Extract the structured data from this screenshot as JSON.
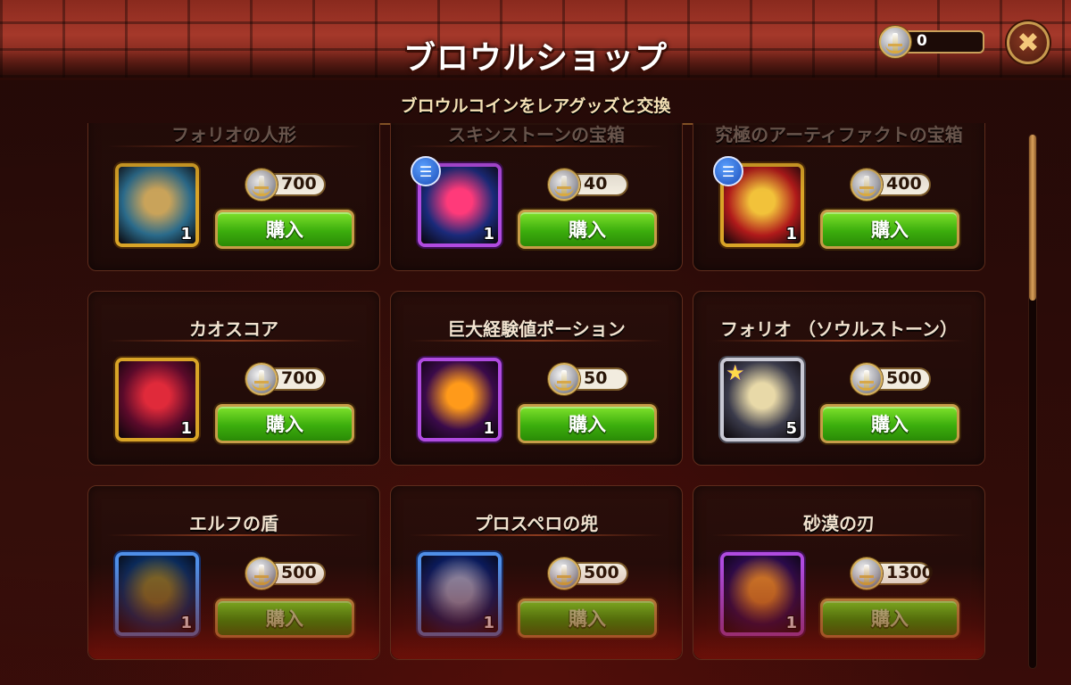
{
  "header": {
    "title": "ブロウルショップ",
    "subtitle": "ブロウルコインをレアグッズと交換",
    "coin_balance": "0",
    "close_icon": "close-icon"
  },
  "shop": {
    "buy_label": "購入",
    "items": [
      {
        "name": "フォリオの人形",
        "price": "700",
        "qty": "1",
        "frame": "gold",
        "info": false,
        "icon": "doll-icon",
        "colors": [
          "#2a6a8a",
          "#c9a35a"
        ]
      },
      {
        "name": "スキンストーンの宝箱",
        "price": "40",
        "qty": "1",
        "frame": "purple",
        "info": true,
        "icon": "skin-chest-icon",
        "colors": [
          "#1a2a7a",
          "#ff3a7a"
        ]
      },
      {
        "name": "究極のアーティファクトの宝箱",
        "price": "400",
        "qty": "1",
        "frame": "gold",
        "info": true,
        "icon": "artifact-chest-icon",
        "colors": [
          "#b01a1a",
          "#f2c23a"
        ]
      },
      {
        "name": "カオスコア",
        "price": "700",
        "qty": "1",
        "frame": "gold",
        "info": false,
        "icon": "chaos-core-icon",
        "colors": [
          "#5a0a2a",
          "#e02a3a"
        ]
      },
      {
        "name": "巨大経験値ポーション",
        "price": "50",
        "qty": "1",
        "frame": "purple",
        "info": false,
        "icon": "exp-potion-icon",
        "colors": [
          "#3a0a4a",
          "#ff9a1a"
        ]
      },
      {
        "name": "フォリオ （ソウルストーン）",
        "price": "500",
        "qty": "5",
        "frame": "silver",
        "info": false,
        "icon": "soulstone-icon",
        "colors": [
          "#3a3a4a",
          "#e8d9a8"
        ]
      },
      {
        "name": "エルフの盾",
        "price": "500",
        "qty": "1",
        "frame": "blue",
        "info": false,
        "icon": "elf-shield-icon",
        "colors": [
          "#0a2a5a",
          "#7a6a2a"
        ]
      },
      {
        "name": "プロスペロの兜",
        "price": "500",
        "qty": "1",
        "frame": "blue",
        "info": false,
        "icon": "helmet-icon",
        "colors": [
          "#0a1a5a",
          "#8a8aa8"
        ]
      },
      {
        "name": "砂漠の刃",
        "price": "1300",
        "qty": "1",
        "frame": "purple",
        "info": false,
        "icon": "desert-blade-icon",
        "colors": [
          "#2a0a4a",
          "#d07a2a"
        ]
      }
    ]
  },
  "scrollbar": {
    "position": 0
  }
}
